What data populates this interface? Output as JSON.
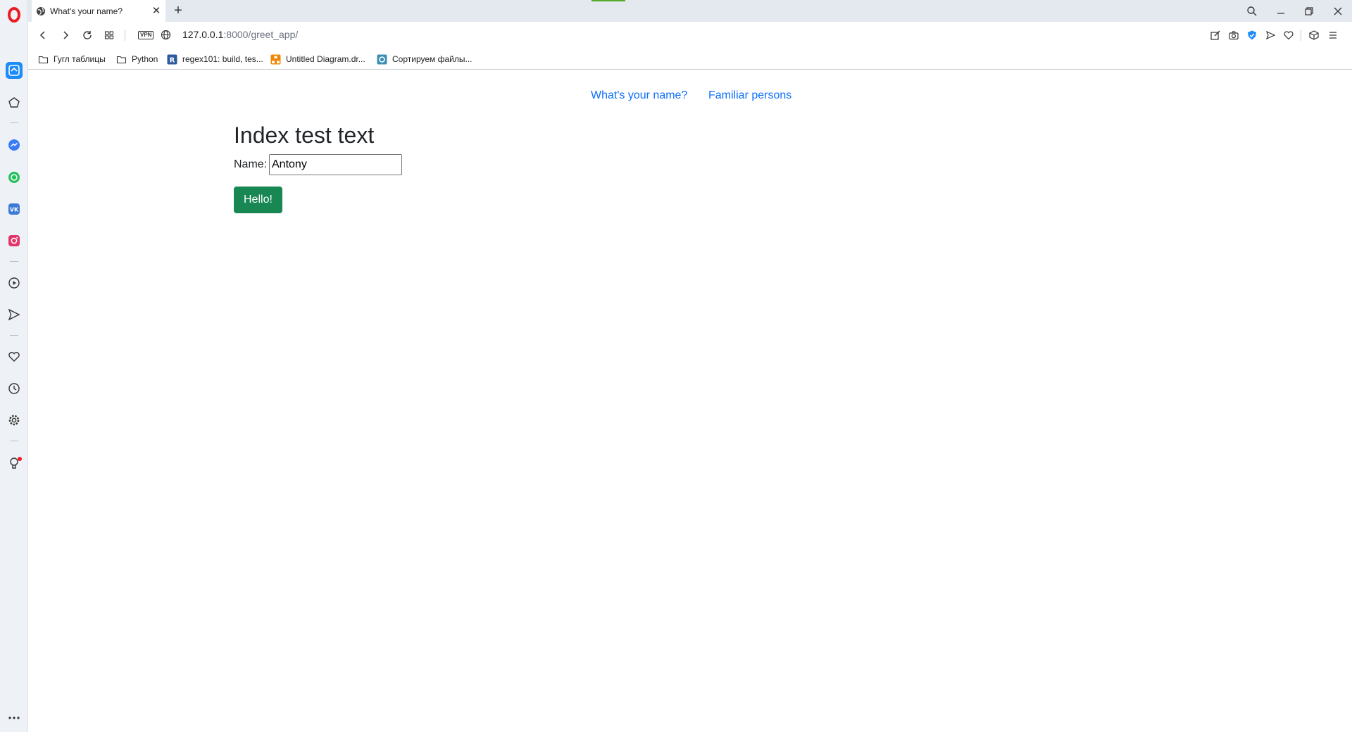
{
  "browser": {
    "tab": {
      "title": "What's your name?"
    },
    "address": {
      "host": "127.0.0.1",
      "path": ":8000/greet_app/"
    },
    "vpn_label": "VPN",
    "bookmarks": [
      {
        "label": "Гугл таблицы",
        "icon": "folder-icon"
      },
      {
        "label": "Python",
        "icon": "folder-icon"
      },
      {
        "label": "regex101: build, tes...",
        "icon": "regex101-icon"
      },
      {
        "label": "Untitled Diagram.dr...",
        "icon": "drawio-icon"
      },
      {
        "label": "Сортируем файлы...",
        "icon": "site-icon"
      }
    ],
    "sidebar": [
      "home-icon",
      "speed-dial-icon",
      "messenger-icon",
      "whatsapp-icon",
      "vk-icon",
      "instagram-icon",
      "player-icon",
      "send-icon",
      "heart-icon",
      "history-icon",
      "settings-icon",
      "lightbulb-icon",
      "more-icon"
    ],
    "colors": {
      "accent": "#1d8cf8",
      "opera_red": "#ec1c24"
    }
  },
  "page": {
    "nav": {
      "link1": "What's your name?",
      "link2": "Familiar persons"
    },
    "heading": "Index test text",
    "form": {
      "label": "Name:",
      "value": "Antony",
      "button": "Hello!"
    },
    "colors": {
      "link": "#0d6efd",
      "button": "#198754"
    }
  }
}
